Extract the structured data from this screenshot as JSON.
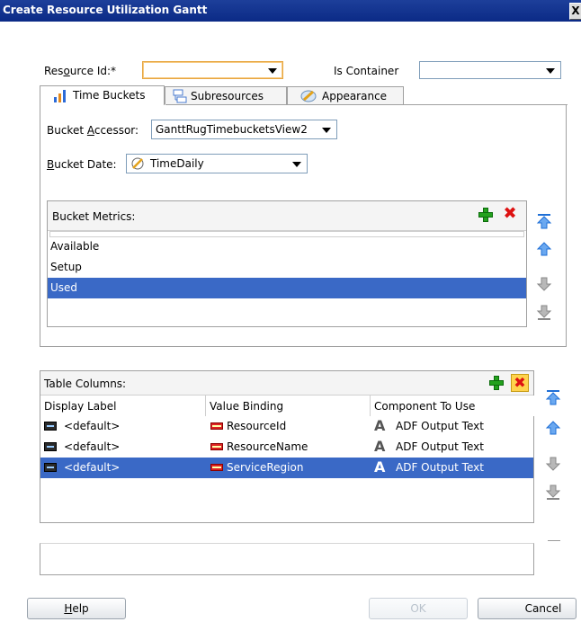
{
  "window": {
    "title": "Create Resource Utilization Gantt",
    "close_glyph": "X"
  },
  "resource": {
    "label_pre": "Res",
    "label_u": "o",
    "label_post": "urce Id:*",
    "value": "",
    "is_container_label": "Is Container",
    "is_container_value": ""
  },
  "tabs": [
    {
      "label": "Time Buckets",
      "icon": "time-buckets-icon"
    },
    {
      "label": "Subresources",
      "icon": "subresources-icon"
    },
    {
      "label": "Appearance",
      "icon": "appearance-icon"
    }
  ],
  "bucket": {
    "accessor_pre": "Bucket ",
    "accessor_u": "A",
    "accessor_post": "ccessor:",
    "accessor_value": "GanttRugTimebucketsView2",
    "date_u": "B",
    "date_post": "ucket Date:",
    "date_value": "TimeDaily"
  },
  "bucket_metrics": {
    "title": "Bucket Metrics:",
    "items": [
      "Available",
      "Setup",
      "Used"
    ],
    "selected_index": 2
  },
  "table_columns": {
    "title": "Table Columns:",
    "headers": [
      "Display Label",
      "Value Binding",
      "Component To Use"
    ],
    "rows": [
      {
        "label": "<default>",
        "binding": "ResourceId",
        "component": "ADF Output Text"
      },
      {
        "label": "<default>",
        "binding": "ResourceName",
        "component": "ADF Output Text"
      },
      {
        "label": "<default>",
        "binding": "ServiceRegion",
        "component": "ADF Output Text"
      }
    ],
    "selected_index": 2
  },
  "buttons": {
    "help_u": "H",
    "help_post": "elp",
    "ok": "OK",
    "cancel": "Cancel"
  },
  "colors": {
    "titlebar": "#0b2a86",
    "selection": "#3a69c6",
    "add": "#23a11d",
    "delete": "#dd1111",
    "move": "#1f6fd6"
  }
}
